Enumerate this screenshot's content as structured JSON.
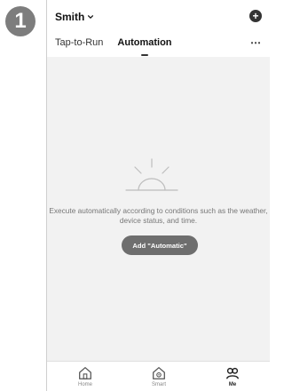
{
  "step_number": "1",
  "header": {
    "home_name": "Smith",
    "tabs": [
      {
        "label": "Tap-to-Run"
      },
      {
        "label": "Automation",
        "active": true
      }
    ],
    "more_icon": "more-horizontal-icon",
    "add_icon": "plus-circle-icon"
  },
  "main": {
    "empty_text": "Execute automatically according to conditions such as the weather, device status, and time.",
    "cta_label": "Add \"Automatic\""
  },
  "bottom_nav": [
    {
      "label": "Home",
      "icon": "home-icon"
    },
    {
      "label": "Smart",
      "icon": "smart-home-icon"
    },
    {
      "label": "Me",
      "icon": "profile-icon",
      "active": true
    }
  ],
  "colors": {
    "background": "#f2f2f2",
    "button": "#6e6e6e",
    "badge": "#7d7d7d"
  }
}
